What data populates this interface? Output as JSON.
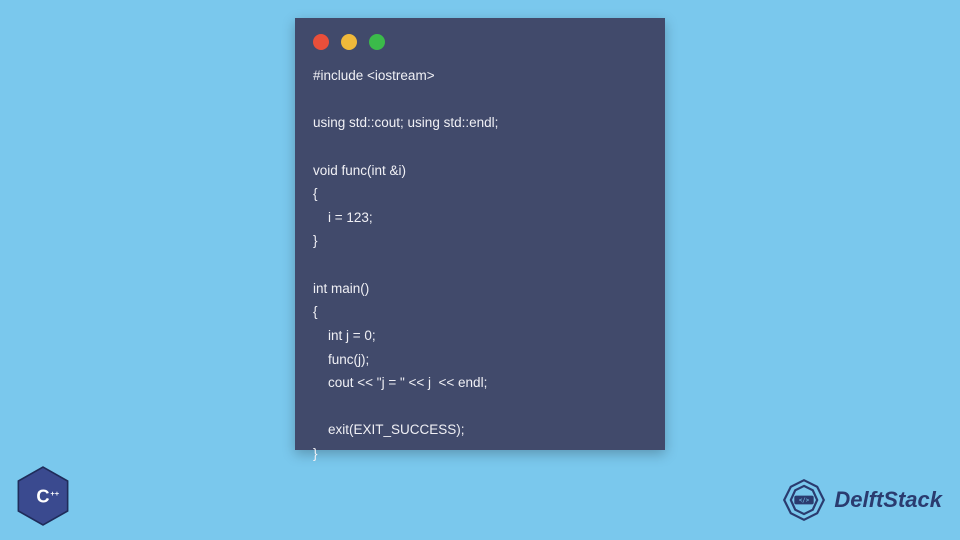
{
  "window": {
    "controls": [
      "close",
      "minimize",
      "zoom"
    ]
  },
  "code": {
    "language": "C++",
    "lines": [
      "#include <iostream>",
      "",
      "using std::cout; using std::endl;",
      "",
      "void func(int &i)",
      "{",
      "    i = 123;",
      "}",
      "",
      "int main()",
      "{",
      "    int j = 0;",
      "    func(j);",
      "    cout << \"j = \" << j  << endl;",
      "",
      "    exit(EXIT_SUCCESS);",
      "}"
    ]
  },
  "badge": {
    "label": "C++"
  },
  "brand": {
    "name": "DelftStack"
  }
}
